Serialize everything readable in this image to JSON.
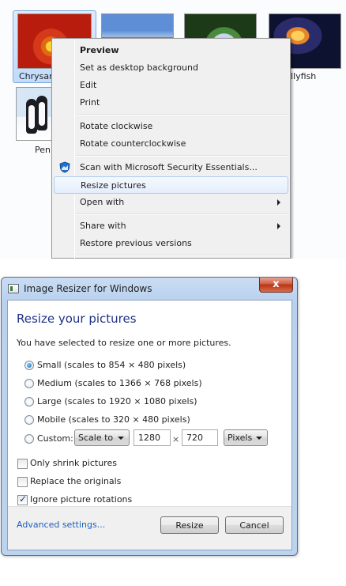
{
  "explorer": {
    "thumbnails": [
      {
        "label": "Chrysan"
      },
      {
        "label": ""
      },
      {
        "label": ""
      },
      {
        "label": "Jellyfish"
      },
      {
        "label": "Pen"
      }
    ]
  },
  "context_menu": {
    "items": [
      {
        "label": "Preview"
      },
      {
        "label": "Set as desktop background"
      },
      {
        "label": "Edit"
      },
      {
        "label": "Print"
      },
      {
        "label": "Rotate clockwise"
      },
      {
        "label": "Rotate counterclockwise"
      },
      {
        "label": "Scan with Microsoft Security Essentials..."
      },
      {
        "label": "Resize pictures"
      },
      {
        "label": "Open with"
      },
      {
        "label": "Share with"
      },
      {
        "label": "Restore previous versions"
      }
    ]
  },
  "dialog": {
    "title": "Image Resizer for Windows",
    "close_label": "x",
    "heading": "Resize your pictures",
    "intro": "You have selected to resize one or more pictures.",
    "sizes": [
      {
        "label": "Small (scales to 854 × 480 pixels)",
        "selected": true
      },
      {
        "label": "Medium (scales to 1366 × 768 pixels)",
        "selected": false
      },
      {
        "label": "Large (scales to 1920 × 1080 pixels)",
        "selected": false
      },
      {
        "label": "Mobile (scales to 320 × 480 pixels)",
        "selected": false
      },
      {
        "label": "Custom:",
        "selected": false
      }
    ],
    "custom": {
      "mode": "Scale to",
      "width": "1280",
      "times": "×",
      "height": "720",
      "unit": "Pixels"
    },
    "options": [
      {
        "label": "Only shrink pictures",
        "checked": false
      },
      {
        "label": "Replace the originals",
        "checked": false
      },
      {
        "label": "Ignore picture rotations",
        "checked": true
      }
    ],
    "advanced_link": "Advanced settings...",
    "resize_button": "Resize",
    "cancel_button": "Cancel"
  },
  "colors": {
    "accent_heading": "#1e3287",
    "link": "#1e5fbf",
    "selection": "#c1dbfc"
  }
}
